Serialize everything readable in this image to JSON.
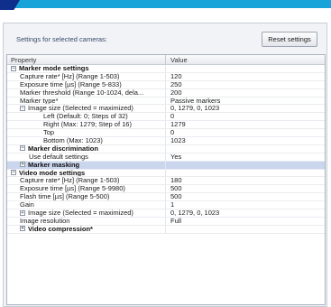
{
  "header": {
    "title": "Settings for selected cameras:",
    "reset_label": "Reset settings"
  },
  "columns": {
    "property": "Property",
    "value": "Value"
  },
  "rows": [
    {
      "label": "Marker mode settings",
      "value": "",
      "type": "cat",
      "level": 1,
      "expander": "−"
    },
    {
      "label": "Capture rate* [Hz] (Range 1-503)",
      "value": "120",
      "type": "prop",
      "level": 2
    },
    {
      "label": "Exposure time [µs] (Range 5-833)",
      "value": "250",
      "type": "prop",
      "level": 2
    },
    {
      "label": "Marker threshold (Range 10-1024, dela...",
      "value": "200",
      "type": "prop",
      "level": 2
    },
    {
      "label": "Marker type*",
      "value": "Passive markers",
      "type": "prop",
      "level": 2
    },
    {
      "label": "Image size (Selected = maximized)",
      "value": "0, 1279, 0, 1023",
      "type": "prop",
      "level": 2,
      "expander": "−"
    },
    {
      "label": "Left (Default: 0; Steps of 32)",
      "value": "0",
      "type": "prop",
      "level": 4
    },
    {
      "label": "Right (Max: 1279; Step of 16)",
      "value": "1279",
      "type": "prop",
      "level": 4
    },
    {
      "label": "Top",
      "value": "0",
      "type": "prop",
      "level": 4
    },
    {
      "label": "Bottom (Max: 1023)",
      "value": "1023",
      "type": "prop",
      "level": 4
    },
    {
      "label": "Marker discrimination",
      "value": "",
      "type": "cat",
      "level": 2,
      "expander": "−"
    },
    {
      "label": "Use default settings",
      "value": "Yes",
      "type": "prop",
      "level": 3
    },
    {
      "label": "Marker masking",
      "value": "",
      "type": "cat",
      "level": 2,
      "expander": "+",
      "selected": true
    },
    {
      "label": "Video mode settings",
      "value": "",
      "type": "cat",
      "level": 1,
      "expander": "−"
    },
    {
      "label": "Capture rate* [Hz] (Range 1-503)",
      "value": "180",
      "type": "prop",
      "level": 2
    },
    {
      "label": "Exposure time [µs] (Range 5-9980)",
      "value": "500",
      "type": "prop",
      "level": 2
    },
    {
      "label": "Flash time [µs] (Range 5-500)",
      "value": "500",
      "type": "prop",
      "level": 2
    },
    {
      "label": "Gain",
      "value": "1",
      "type": "prop",
      "level": 2
    },
    {
      "label": "Image size (Selected = maximized)",
      "value": "0, 1279, 0, 1023",
      "type": "prop",
      "level": 2,
      "expander": "+"
    },
    {
      "label": "Image resolution",
      "value": "Full",
      "type": "prop",
      "level": 2
    },
    {
      "label": "Video compression*",
      "value": "",
      "type": "cat",
      "level": 2,
      "expander": "+"
    }
  ]
}
